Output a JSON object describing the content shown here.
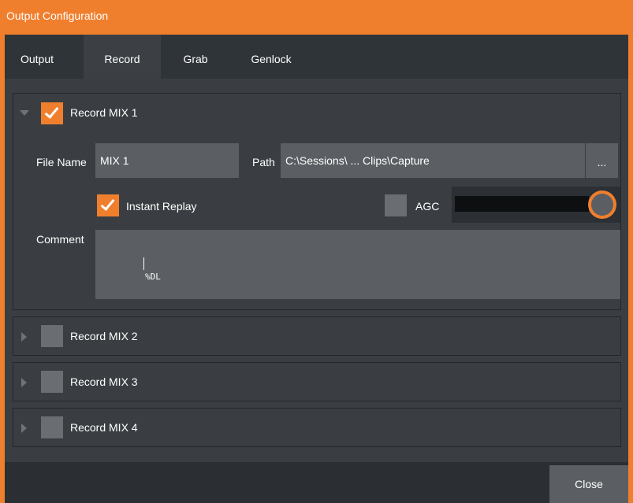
{
  "window": {
    "title": "Output Configuration"
  },
  "tabs": [
    {
      "label": "Output",
      "active": false
    },
    {
      "label": "Record",
      "active": true
    },
    {
      "label": "Grab",
      "active": false
    },
    {
      "label": "Genlock",
      "active": false
    }
  ],
  "records": [
    {
      "title": "Record MIX 1",
      "expanded": true,
      "checked": true,
      "file_name_label": "File Name",
      "file_name_value": "MIX 1",
      "path_label": "Path",
      "path_value": "C:\\Sessions\\ ... Clips\\Capture",
      "browse_label": "...",
      "instant_replay_label": "Instant Replay",
      "instant_replay_checked": true,
      "agc_label": "AGC",
      "agc_checked": false,
      "comment_label": "Comment",
      "comment_value": ""
    },
    {
      "title": "Record MIX 2",
      "expanded": false,
      "checked": false
    },
    {
      "title": "Record MIX 3",
      "expanded": false,
      "checked": false
    },
    {
      "title": "Record MIX 4",
      "expanded": false,
      "checked": false
    }
  ],
  "cursor_overlay": "%DL",
  "footer": {
    "close_label": "Close"
  },
  "colors": {
    "accent": "#f07f2d",
    "panel": "#3a3e42",
    "field": "#5b5f63"
  }
}
